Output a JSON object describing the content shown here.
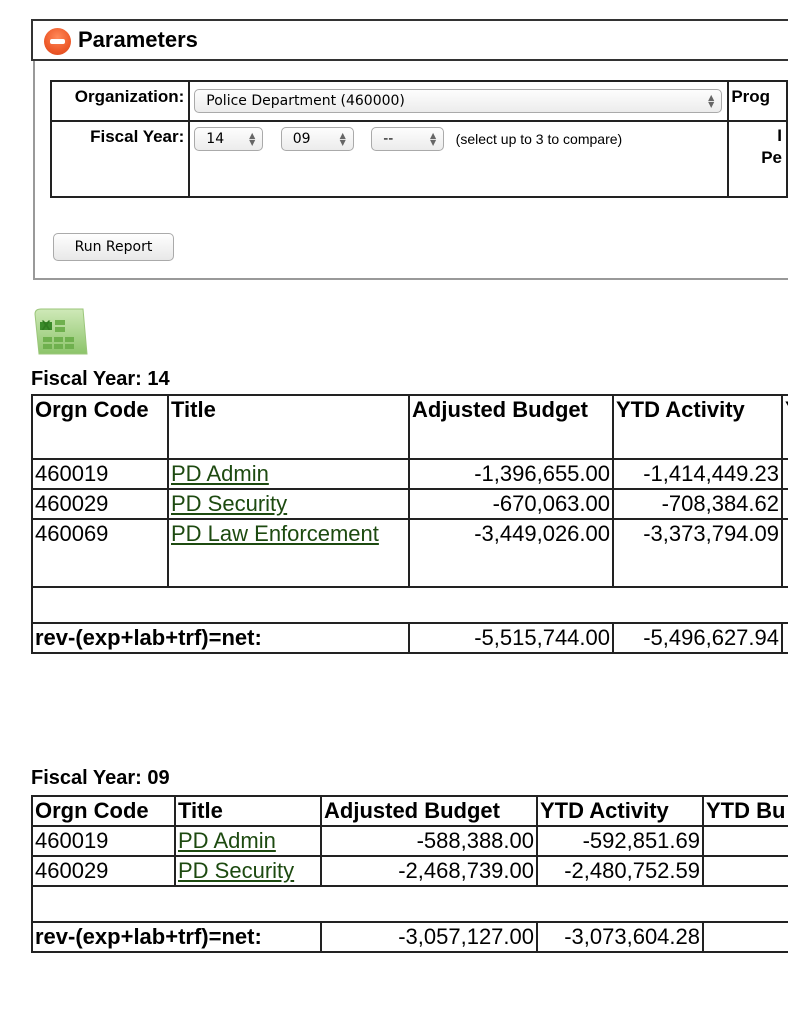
{
  "parameters": {
    "title": "Parameters",
    "collapse_icon": "minus-circle-icon",
    "organization_label": "Organization:",
    "organization_value": "Police Department (460000)",
    "program_label_partial": "Prog",
    "fiscal_year_label": "Fiscal Year:",
    "fiscal_year_selects": [
      "14",
      "09",
      "--"
    ],
    "fiscal_year_hint": "(select up to 3 to compare)",
    "period_label_partial_1": "I",
    "period_label_partial_2": "Pe",
    "run_report_label": "Run Report"
  },
  "export_icon": "excel-export-icon",
  "reports": [
    {
      "heading": "Fiscal Year: 14",
      "headers": [
        "Orgn Code",
        "Title",
        "Adjusted Budget",
        "YTD Activity",
        "Y"
      ],
      "rows": [
        {
          "code": "460019",
          "title": "PD Admin",
          "budget": "-1,396,655.00",
          "activity": "-1,414,449.23"
        },
        {
          "code": "460029",
          "title": "PD Security",
          "budget": "-670,063.00",
          "activity": "-708,384.62"
        },
        {
          "code": "460069",
          "title": "PD Law Enforcement",
          "budget": "-3,449,026.00",
          "activity": "-3,373,794.09"
        }
      ],
      "net_label": "rev-(exp+lab+trf)=net:",
      "net_budget": "-5,515,744.00",
      "net_activity": "-5,496,627.94"
    },
    {
      "heading": "Fiscal Year: 09",
      "headers": [
        "Orgn Code",
        "Title",
        "Adjusted Budget",
        "YTD Activity",
        "YTD Bu"
      ],
      "rows": [
        {
          "code": "460019",
          "title": "PD Admin",
          "budget": "-588,388.00",
          "activity": "-592,851.69"
        },
        {
          "code": "460029",
          "title": "PD Security",
          "budget": "-2,468,739.00",
          "activity": "-2,480,752.59"
        }
      ],
      "net_label": "rev-(exp+lab+trf)=net:",
      "net_budget": "-3,057,127.00",
      "net_activity": "-3,073,604.28"
    }
  ],
  "colors": {
    "link": "#1d4a10",
    "collapse_icon": "#ee5a2a"
  }
}
